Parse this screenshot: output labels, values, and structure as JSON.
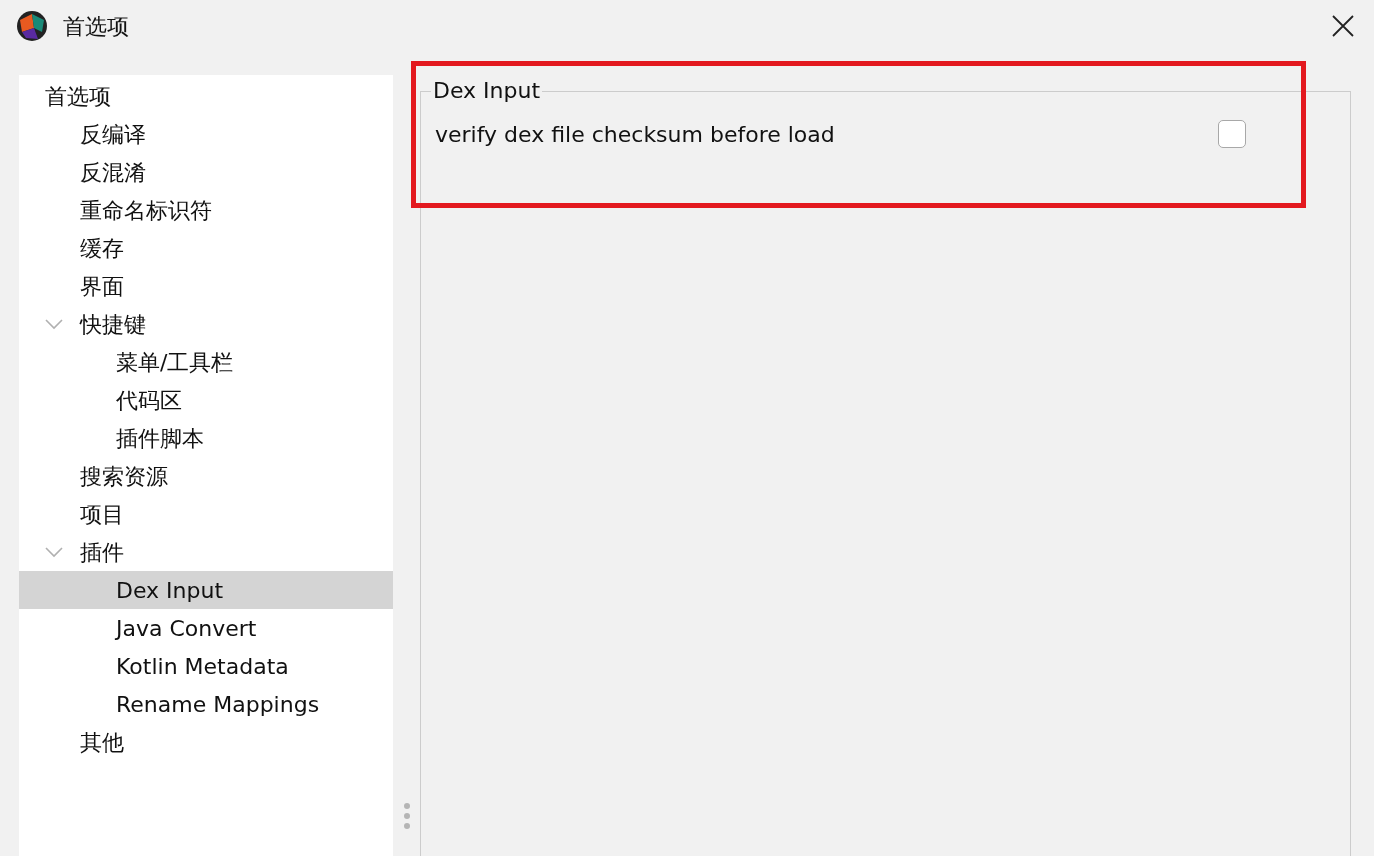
{
  "window": {
    "title": "首选项"
  },
  "tree": [
    {
      "label": "首选项",
      "selected": false,
      "children": [
        {
          "label": "反编译",
          "selected": false
        },
        {
          "label": "反混淆",
          "selected": false
        },
        {
          "label": "重命名标识符",
          "selected": false
        },
        {
          "label": "缓存",
          "selected": false
        },
        {
          "label": "界面",
          "selected": false
        },
        {
          "label": "快捷键",
          "selected": false,
          "expanded": true,
          "children": [
            {
              "label": "菜单/工具栏",
              "selected": false
            },
            {
              "label": "代码区",
              "selected": false
            },
            {
              "label": "插件脚本",
              "selected": false
            }
          ]
        },
        {
          "label": "搜索资源",
          "selected": false
        },
        {
          "label": "项目",
          "selected": false
        },
        {
          "label": "插件",
          "selected": false,
          "expanded": true,
          "children": [
            {
              "label": "Dex Input",
              "selected": true
            },
            {
              "label": "Java Convert",
              "selected": false
            },
            {
              "label": "Kotlin Metadata",
              "selected": false
            },
            {
              "label": "Rename Mappings",
              "selected": false
            }
          ]
        },
        {
          "label": "其他",
          "selected": false
        }
      ]
    }
  ],
  "group": {
    "title": "Dex Input",
    "options": [
      {
        "label": "verify dex file checksum before load",
        "checked": false
      }
    ]
  },
  "highlight": {
    "color": "#e3191f"
  }
}
